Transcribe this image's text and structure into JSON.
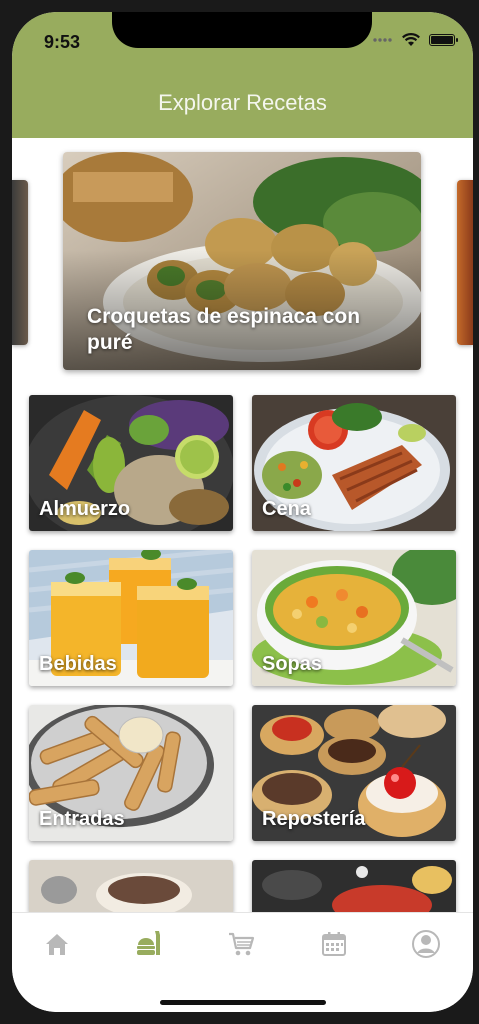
{
  "status_bar": {
    "time": "9:53"
  },
  "header": {
    "title": "Explorar Recetas"
  },
  "featured": {
    "label": "Croquetas de espinaca con puré"
  },
  "categories": [
    {
      "label": "Almuerzo"
    },
    {
      "label": "Cena"
    },
    {
      "label": "Bebidas"
    },
    {
      "label": "Sopas"
    },
    {
      "label": "Entradas"
    },
    {
      "label": "Repostería"
    }
  ],
  "tabbar": {
    "items": [
      {
        "icon": "home-icon",
        "active": false
      },
      {
        "icon": "recipes-icon",
        "active": true
      },
      {
        "icon": "cart-icon",
        "active": false
      },
      {
        "icon": "calendar-icon",
        "active": false
      },
      {
        "icon": "profile-icon",
        "active": false
      }
    ],
    "active_color": "#98ac5e",
    "inactive_color": "#b8b8b8"
  },
  "colors": {
    "header": "#98ac5e",
    "header_text": "#f4f6ee"
  }
}
